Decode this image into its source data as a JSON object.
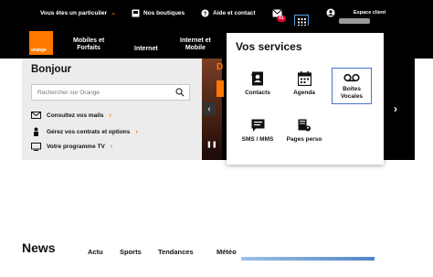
{
  "topbar": {
    "segment": "Vous êtes un particulier",
    "stores": "Nos boutiques",
    "help": "Aide et contact",
    "mail_badge": "41",
    "account": "Espace client"
  },
  "logo": {
    "text": "orange"
  },
  "nav": {
    "mobiles_forfaits": "Mobiles et\nForfaits",
    "internet": "Internet",
    "internet_mobile": "Internet et\nMobile"
  },
  "home": {
    "greeting": "Bonjour",
    "search_placeholder": "Rechercher sur Orange",
    "links": [
      {
        "label": "Consultez vos mails"
      },
      {
        "label": "Gérez vos contrats et options"
      },
      {
        "label": "Votre programme TV"
      }
    ]
  },
  "hero": {
    "fragment": "D"
  },
  "services": {
    "title": "Vos services",
    "items": [
      {
        "label": "Contacts"
      },
      {
        "label": "Agenda"
      },
      {
        "label": "Boîtes\nVocales"
      },
      {
        "label": "SMS / MMS"
      },
      {
        "label": "Pages perso"
      }
    ]
  },
  "news": {
    "title": "News",
    "tabs": [
      "Actu",
      "Sports",
      "Tendances",
      "Météo"
    ]
  },
  "colors": {
    "brand": "#ff7900",
    "badge": "#e4002b",
    "highlight": "#4b76c8"
  },
  "icons": [
    "store-icon",
    "help-icon",
    "mail-icon",
    "apps-grid-icon",
    "user-icon",
    "search-icon",
    "mail-small-icon",
    "contract-icon",
    "tv-icon",
    "contacts-icon",
    "agenda-icon",
    "voicemail-icon",
    "sms-icon",
    "pages-perso-icon"
  ]
}
